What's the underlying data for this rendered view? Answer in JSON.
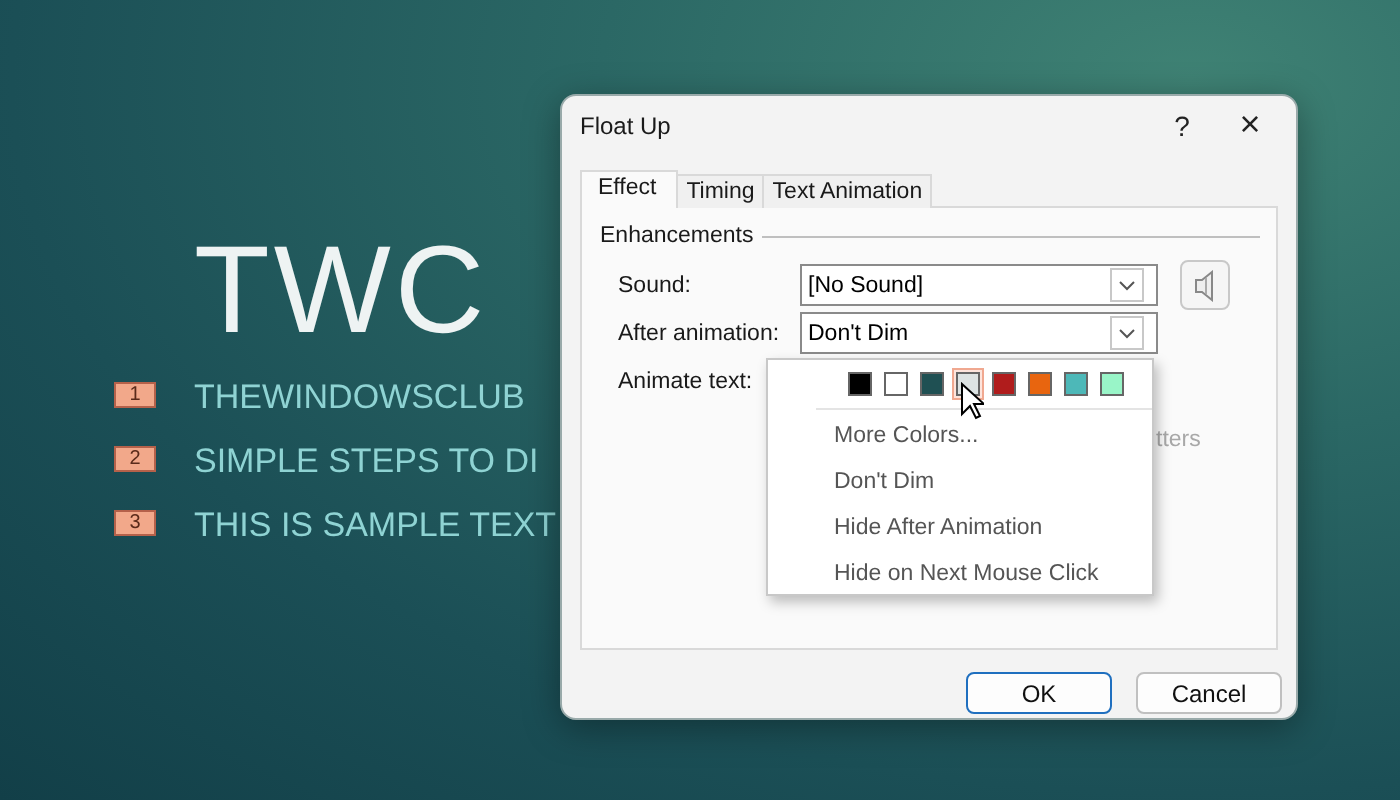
{
  "slide": {
    "title": "TWC",
    "items": [
      {
        "number": "1",
        "text": "THEWINDOWSCLUB"
      },
      {
        "number": "2",
        "text": "SIMPLE STEPS TO DI"
      },
      {
        "number": "3",
        "text": "THIS IS SAMPLE TEXT"
      }
    ]
  },
  "dialog": {
    "title": "Float Up",
    "help": "?",
    "close": "×",
    "tabs": [
      {
        "label": "Effect",
        "selected": true
      },
      {
        "label": "Timing",
        "selected": false
      },
      {
        "label": "Text Animation",
        "selected": false
      }
    ],
    "group": "Enhancements",
    "fields": [
      {
        "kind": "combo",
        "label": "Sound:",
        "value": "[No Sound]",
        "preview_button": true
      },
      {
        "kind": "combo",
        "label": "After animation:",
        "value": "Don't Dim",
        "preview_button": false
      },
      {
        "kind": "covered",
        "label": "Animate text:"
      }
    ],
    "hint_fragment": "tters",
    "popup": {
      "swatches": [
        {
          "color": "#000000",
          "selected": false
        },
        {
          "color": "#ffffff",
          "selected": false
        },
        {
          "color": "#1f5053",
          "selected": false
        },
        {
          "color": "#dde3e3",
          "selected": true
        },
        {
          "color": "#b01c1c",
          "selected": false
        },
        {
          "color": "#e8650f",
          "selected": false
        },
        {
          "color": "#4db8b8",
          "selected": false
        },
        {
          "color": "#99f5c8",
          "selected": false
        }
      ],
      "items": [
        "More Colors...",
        "Don't Dim",
        "Hide After Animation",
        "Hide on Next Mouse Click"
      ]
    },
    "buttons": [
      {
        "label": "OK",
        "default": true
      },
      {
        "label": "Cancel",
        "default": false
      }
    ]
  }
}
